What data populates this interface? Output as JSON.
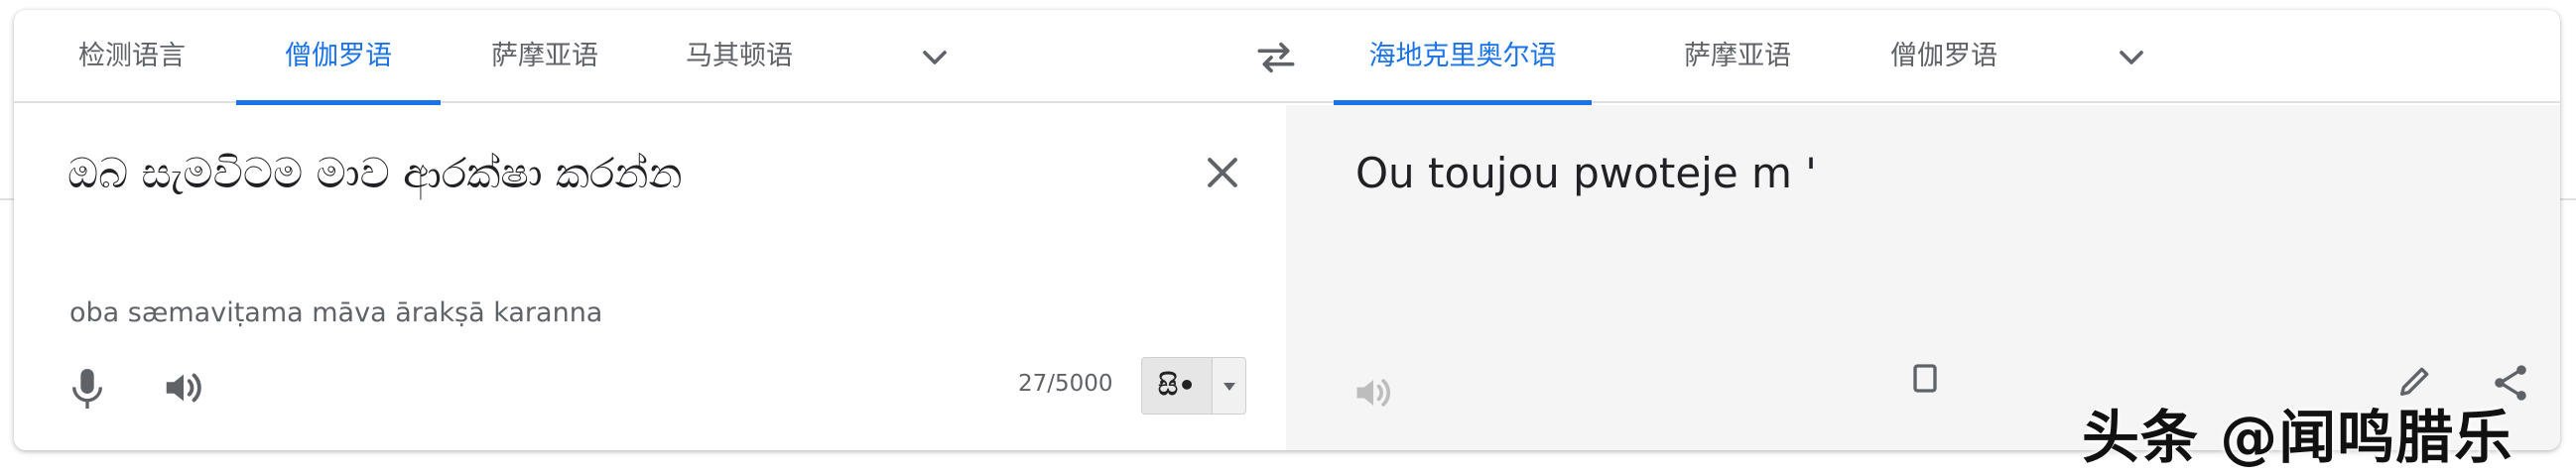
{
  "source_languages": {
    "tabs": [
      {
        "label": "检测语言",
        "active": false
      },
      {
        "label": "僧伽罗语",
        "active": true
      },
      {
        "label": "萨摩亚语",
        "active": false
      },
      {
        "label": "马其顿语",
        "active": false
      }
    ],
    "more_icon": "chevron-down-icon"
  },
  "swap_icon": "swap-horiz-icon",
  "target_languages": {
    "tabs": [
      {
        "label": "海地克里奥尔语",
        "active": true
      },
      {
        "label": "萨摩亚语",
        "active": false
      },
      {
        "label": "僧伽罗语",
        "active": false
      }
    ],
    "more_icon": "chevron-down-icon"
  },
  "source": {
    "text": "ඔබ සැමවිටම මාව ආරක්ෂා කරන්න",
    "transliteration": "oba sæmaviṭama māva ārakṣā karanna",
    "char_count": "27/5000",
    "ime_label": "සි•"
  },
  "target": {
    "text": "Ou toujou pwoteje m '"
  },
  "watermark": "头条 @闻鸣腊乐",
  "colors": {
    "accent": "#1a73e8",
    "muted": "#5f6368",
    "target_bg": "#f5f5f5"
  }
}
